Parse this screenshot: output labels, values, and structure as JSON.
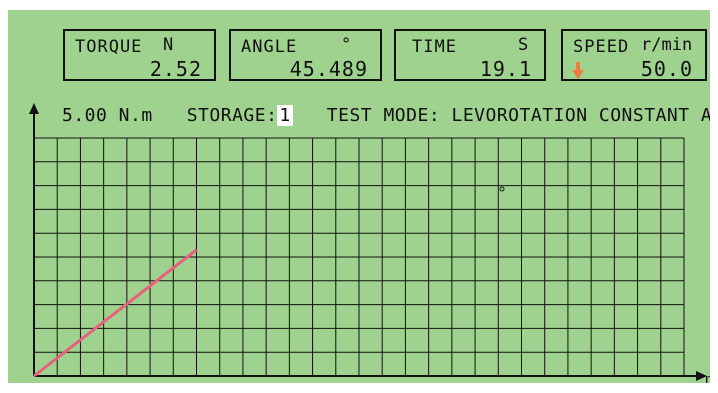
{
  "readouts": {
    "torque": {
      "label": "TORQUE",
      "unit": "N",
      "value": "2.52"
    },
    "angle": {
      "label": "ANGLE",
      "unit": "°",
      "value": "45.489"
    },
    "time": {
      "label": "TIME",
      "unit": "S",
      "value": "19.1"
    },
    "speed": {
      "label": "SPEED",
      "unit": "r/min",
      "value": "50.0"
    }
  },
  "status": {
    "torque_setting": "5.00 N.m",
    "storage_label": "STORAGE:",
    "storage_value": "1",
    "mode_label": "TEST MODE:",
    "mode_value": "LEVOROTATION CONSTANT ANGLE"
  },
  "axis": {
    "x_label_partial": "m"
  },
  "colors": {
    "screen_bg": "#9fd28e",
    "grid": "#111111",
    "trace": "#e8607a",
    "direction_arrow": "#f07a3a"
  },
  "chart_data": {
    "type": "line",
    "title": "",
    "xlabel": "m",
    "ylabel": "",
    "grid": true,
    "series": [
      {
        "x": [
          0,
          7
        ],
        "y": [
          0,
          5.3
        ]
      }
    ],
    "xlim": [
      0,
      28
    ],
    "ylim": [
      0,
      10
    ]
  }
}
